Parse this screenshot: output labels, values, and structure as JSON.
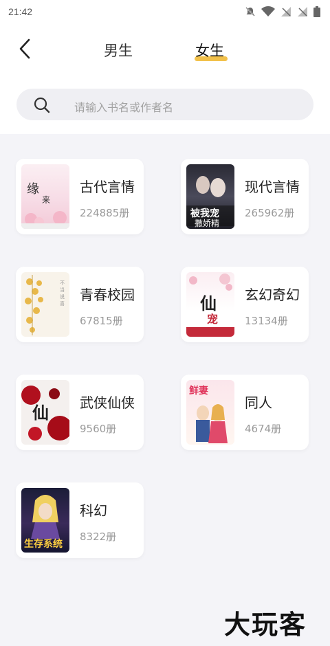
{
  "status": {
    "time": "21:42"
  },
  "nav": {
    "tab_male": "男生",
    "tab_female": "女生",
    "active_tab": "女生",
    "accent_color": "#f2c14b"
  },
  "search": {
    "placeholder": "请输入书名或作者名"
  },
  "categories": [
    {
      "name": "古代言情",
      "count": "224885册"
    },
    {
      "name": "现代言情",
      "count": "265962册"
    },
    {
      "name": "青春校园",
      "count": "67815册"
    },
    {
      "name": "玄幻奇幻",
      "count": "13134册"
    },
    {
      "name": "武侠仙侠",
      "count": "9560册"
    },
    {
      "name": "同人",
      "count": "4674册"
    },
    {
      "name": "科幻",
      "count": "8322册"
    }
  ],
  "watermark": "大玩客"
}
